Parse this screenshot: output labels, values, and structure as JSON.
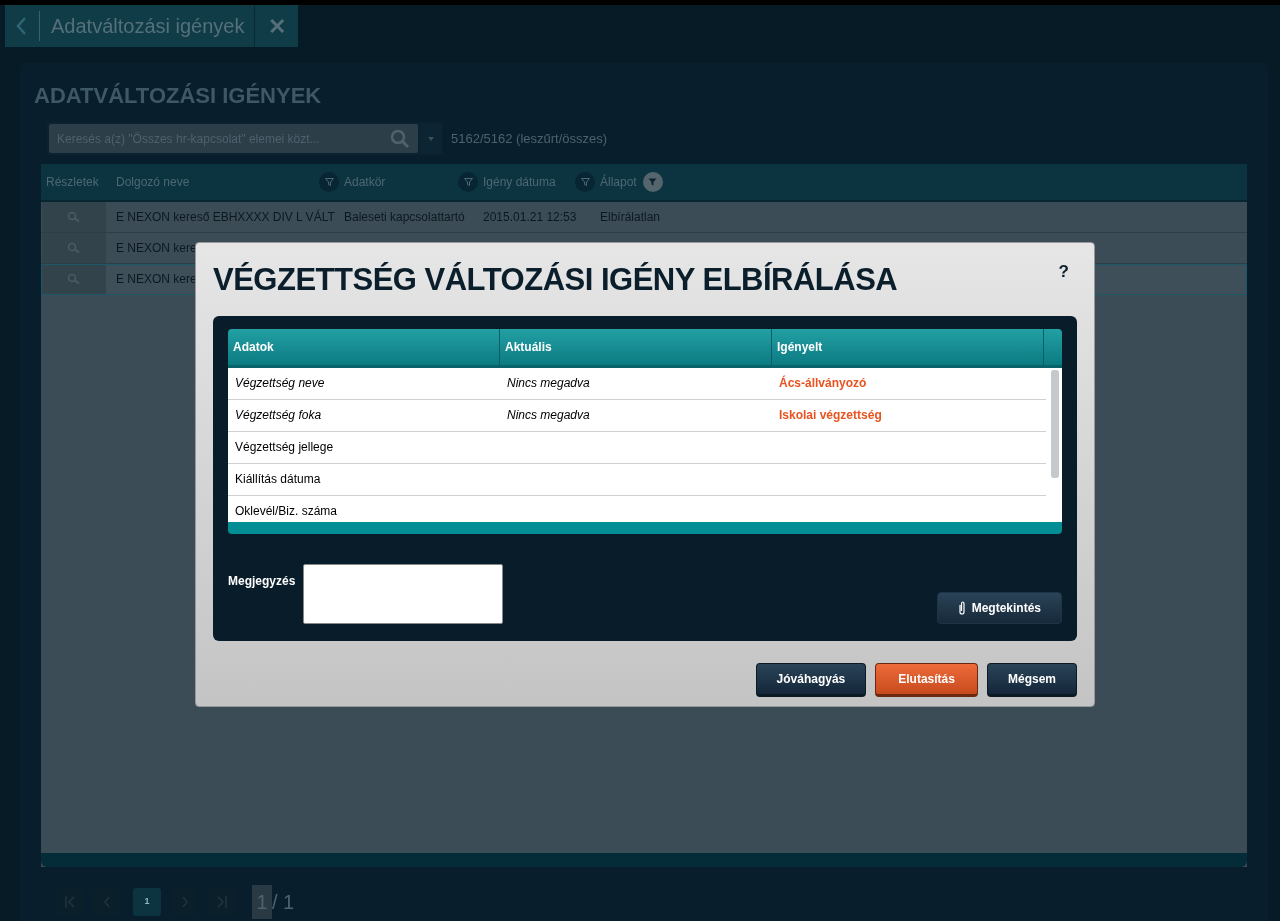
{
  "tab": {
    "title": "Adatváltozási igények",
    "close": "✕"
  },
  "page": {
    "title": "ADATVÁLTOZÁSI IGÉNYEK",
    "search": {
      "placeholder": "Keresés a(z) \"Összes hr-kapcsolat\" elemei közt..."
    },
    "count": "5162/5162 (leszűrt/összes)"
  },
  "table": {
    "details_column": "Részletek",
    "columns": [
      {
        "label": "Dolgozó neve",
        "filter_active": false
      },
      {
        "label": "Adatkör",
        "filter_active": false
      },
      {
        "label": "Igény dátuma",
        "filter_active": false
      },
      {
        "label": "Állapot",
        "filter_active": true
      }
    ],
    "rows": [
      {
        "selected": false,
        "cells": [
          "E NEXON kereső EBHXXXX DIV L VÁLT",
          "Baleseti kapcsolattartó",
          "2015.01.21 12:53",
          "Elbírálatlan"
        ]
      },
      {
        "selected": false,
        "cells": [
          "E NEXON kere"
        ]
      },
      {
        "selected": true,
        "cells": [
          "E NEXON kere"
        ]
      }
    ]
  },
  "pagination": {
    "current_page": "1",
    "page_input": "1",
    "total": "/ 1"
  },
  "dialog": {
    "title": "VÉGZETTSÉG VÁLTOZÁSI IGÉNY ELBÍRÁLÁSA",
    "help": "?",
    "columns": [
      "Adatok",
      "Aktuális",
      "Igényelt"
    ],
    "rows": [
      {
        "changed": true,
        "cells": [
          "Végzettség neve",
          "Nincs megadva",
          "Ács-állványozó"
        ]
      },
      {
        "changed": true,
        "cells": [
          "Végzettség foka",
          "Nincs megadva",
          "Iskolai végzettség"
        ]
      },
      {
        "changed": false,
        "cells": [
          "Végzettség jellege"
        ]
      },
      {
        "changed": false,
        "cells": [
          "Kiállítás dátuma"
        ]
      },
      {
        "changed": false,
        "cells": [
          "Oklevél/Biz. száma"
        ]
      }
    ],
    "note_label": "Megjegyzés",
    "view_button": "Megtekintés",
    "buttons": [
      {
        "label": "Jóváhagyás",
        "kind": "normal"
      },
      {
        "label": "Elutasítás",
        "kind": "danger"
      },
      {
        "label": "Mégsem",
        "kind": "normal"
      }
    ]
  }
}
